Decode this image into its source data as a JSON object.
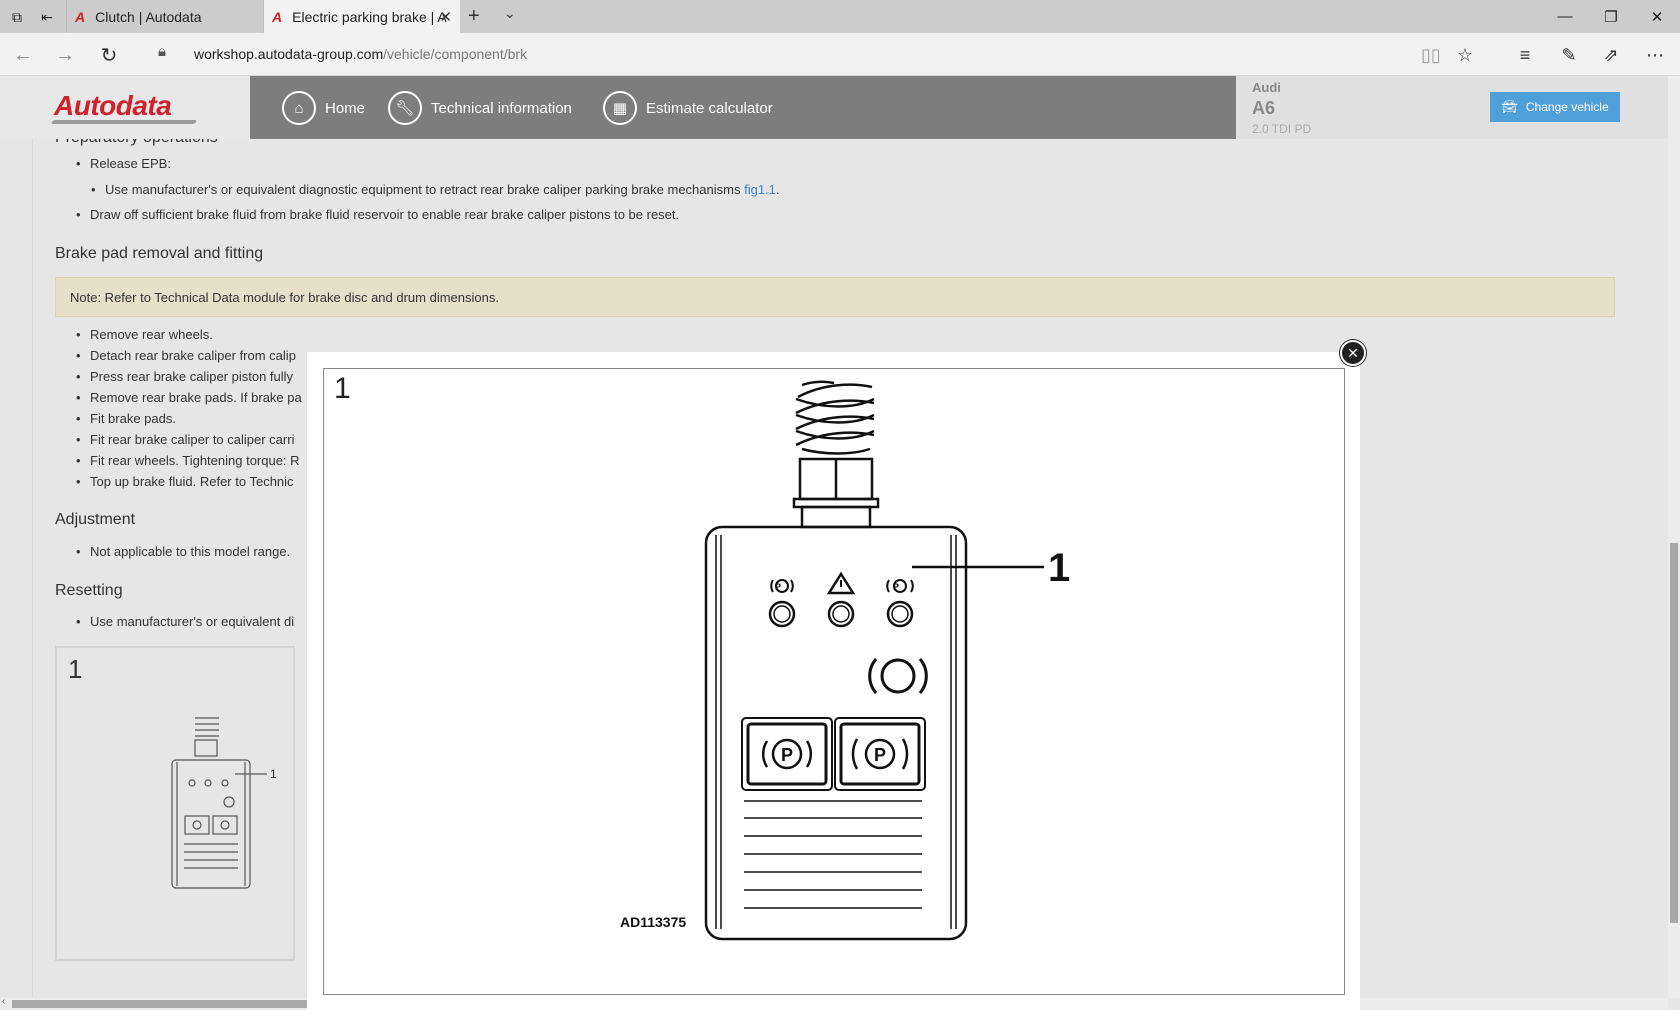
{
  "browser": {
    "tabs": [
      {
        "label": "Clutch | Autodata"
      },
      {
        "label": "Electric parking brake | A"
      }
    ],
    "url_host": "workshop.autodata-group.com",
    "url_path": "/vehicle/component/brk"
  },
  "site": {
    "logo": "Autodata",
    "nav": [
      {
        "label": "Home"
      },
      {
        "label": "Technical information"
      },
      {
        "label": "Estimate calculator"
      }
    ],
    "vehicle": {
      "make": "Audi",
      "model": "A6",
      "engine": "2.0 TDI PD"
    },
    "change_vehicle": "Change vehicle"
  },
  "content": {
    "cut_heading": "Preparatory operations",
    "prep_items": [
      "Release EPB:",
      "Use manufacturer's or equivalent diagnostic equipment to retract rear brake caliper parking brake mechanisms",
      "Draw off sufficient brake fluid from brake fluid reservoir to enable rear brake caliper pistons to be reset."
    ],
    "fig_link": "fig1.1",
    "fig_link_suffix": ".",
    "h_pad": "Brake pad removal and fitting",
    "note": "Note: Refer to Technical Data module for brake disc and drum dimensions.",
    "pad_items": [
      "Remove rear wheels.",
      "Detach rear brake caliper from calip",
      "Press rear brake caliper piston fully",
      "Remove rear brake pads. If brake pa",
      "Fit brake pads.",
      "Fit rear brake caliper to caliper carri",
      "Fit rear wheels. Tightening torque: R",
      "Top up brake fluid. Refer to Technic"
    ],
    "h_adjust": "Adjustment",
    "adjust_items": [
      "Not applicable to this model range."
    ],
    "h_reset": "Resetting",
    "reset_items": [
      "Use manufacturer's or equivalent di"
    ],
    "thumb_num": "1",
    "thumb_callout": "1"
  },
  "modal": {
    "fig_number": "1",
    "callout": "1",
    "figure_code": "AD113375"
  }
}
